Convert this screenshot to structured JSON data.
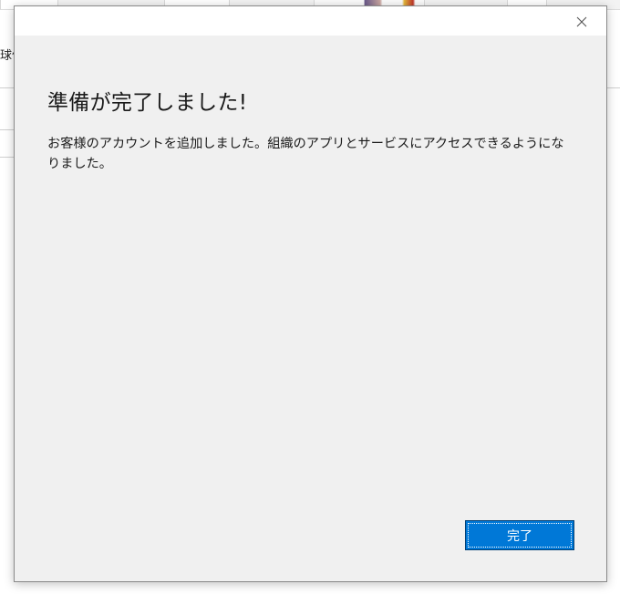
{
  "background": {
    "side_label": "球信"
  },
  "dialog": {
    "close_label": "×",
    "heading": "準備が完了しました!",
    "message": "お客様のアカウントを追加しました。組織のアプリとサービスにアクセスできるようになりました。",
    "done_button_label": "完了"
  },
  "colors": {
    "accent": "#0078d7",
    "dialog_background": "#f0f0f0",
    "titlebar": "#ffffff"
  }
}
